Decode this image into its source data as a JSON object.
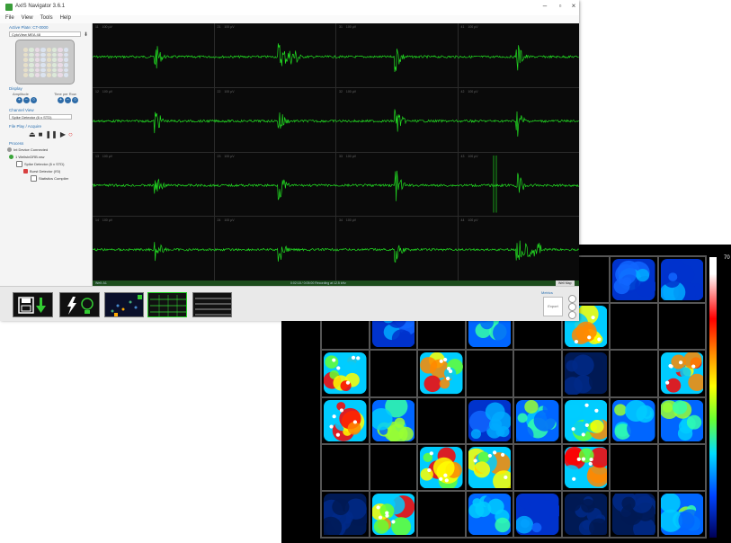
{
  "app": {
    "title": "AxIS Navigator 3.6.1",
    "menu": [
      "File",
      "View",
      "Tools",
      "Help"
    ]
  },
  "left_panel": {
    "active_plate_title": "Active Plate: CT-0000",
    "plate_select": "CytoView MEA 48",
    "display_title": "Display",
    "amplitude_label": "Amplitude",
    "time_label": "Time per Row",
    "channel_view_title": "Channel View",
    "channel_view_select": "Spike Detector (6 x STD)",
    "playback_title": "File Play / Acquire",
    "process_title": "Process",
    "tree": [
      {
        "label": "Int Device Connected",
        "level": 0,
        "color": "#999999"
      },
      {
        "label": "1 WellsInDRB.raw",
        "level": 0,
        "color": "#3aa53a"
      },
      {
        "label": "Spike Detector (6 x STD)",
        "level": 1,
        "color": "#ffffff"
      },
      {
        "label": "Burst Detector (ISI)",
        "level": 2,
        "color": "#d84040"
      },
      {
        "label": "Statistics Compiler",
        "level": 3,
        "color": "#ffffff"
      }
    ]
  },
  "traces": {
    "channel_labels": [
      [
        "11",
        "100 µV",
        "21",
        "100 µV",
        "31",
        "100 µV",
        "41",
        "100 µV"
      ],
      [
        "12",
        "100 µV",
        "22",
        "100 µV",
        "32",
        "100 µV",
        "42",
        "100 µV"
      ],
      [
        "13",
        "100 µV",
        "23",
        "100 µV",
        "33",
        "100 µV",
        "43",
        "100 µV"
      ],
      [
        "14",
        "100 µV",
        "24",
        "100 µV",
        "34",
        "100 µV",
        "44",
        "100 µV"
      ]
    ],
    "trace_color": "#22dd22",
    "status_left": "Well: A1",
    "status_center": "0:02:18 / 0:05:00 Recording at 12.5 kHz",
    "status_right": "Well Map"
  },
  "toolbar": {
    "metrics_label": "Metrics",
    "metrics_button": "Export"
  },
  "heatmap": {
    "colorbar_label": "70"
  },
  "icons": {
    "save": "save-icon",
    "bolt": "lightning-icon",
    "bulb": "lightbulb-icon"
  }
}
